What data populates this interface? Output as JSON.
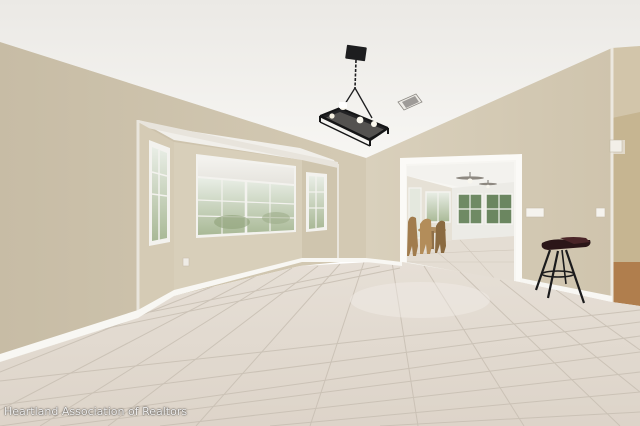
{
  "watermark": {
    "text": "Heartland Association of Realtors"
  },
  "colors": {
    "ceiling": "#f2f1ee",
    "wall_left": "#cdc3ad",
    "wall_right": "#d6ccb7",
    "wall_back": "#dcd3bf",
    "floor_tile": "#e3dbd1",
    "grout": "#c8bfb3",
    "baseboard": "#f7f6f2",
    "window_glass": "#cfd8c4",
    "fixture_metal": "#1d1d1f"
  }
}
